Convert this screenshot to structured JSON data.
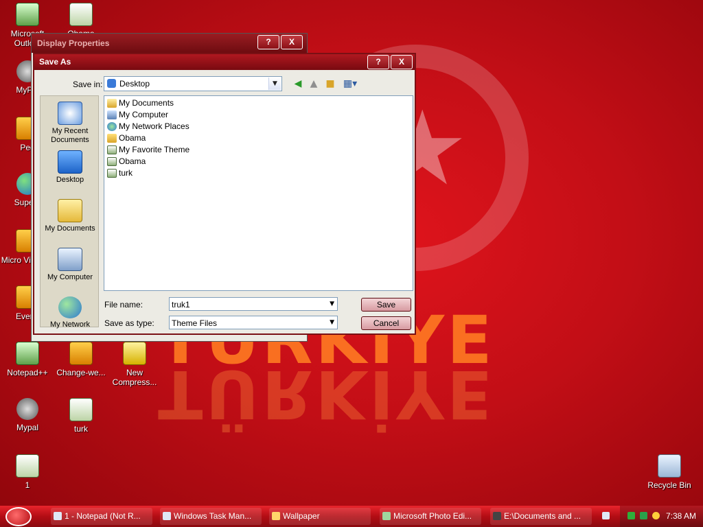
{
  "desktop": {
    "wordmark": "TÜRKİYE",
    "icons": [
      {
        "label": "Microsoft Outlo...",
        "glyph": "outlook-icon"
      },
      {
        "label": "Obama",
        "glyph": "image-file-icon"
      },
      {
        "label": "MyPal",
        "glyph": "raccoon-icon"
      },
      {
        "label": "Peg",
        "glyph": "app-icon"
      },
      {
        "label": "Supern",
        "glyph": "globe-icon"
      },
      {
        "label": "Micro Visual S",
        "glyph": "app-icon"
      },
      {
        "label": "Everyt",
        "glyph": "search-app-icon"
      },
      {
        "label": "Notepad++",
        "glyph": "notepad-icon"
      },
      {
        "label": "Change-we...",
        "glyph": "app-icon"
      },
      {
        "label": "New Compress...",
        "glyph": "zip-folder-icon"
      },
      {
        "label": "Mypal",
        "glyph": "raccoon-icon"
      },
      {
        "label": "turk",
        "glyph": "image-file-icon"
      },
      {
        "label": "1",
        "glyph": "script-icon"
      },
      {
        "label": "Recycle Bin",
        "glyph": "recycle-bin-icon"
      }
    ]
  },
  "back_window": {
    "title": "Display Properties",
    "help": "?",
    "close": "X"
  },
  "dialog": {
    "title": "Save As",
    "help": "?",
    "close": "X",
    "save_in_label": "Save in:",
    "save_in_value": "Desktop",
    "places": [
      {
        "label": "My Recent Documents",
        "icon": "recent-documents-icon"
      },
      {
        "label": "Desktop",
        "icon": "desktop-icon"
      },
      {
        "label": "My Documents",
        "icon": "my-documents-icon"
      },
      {
        "label": "My Computer",
        "icon": "my-computer-icon"
      },
      {
        "label": "My Network",
        "icon": "network-icon"
      }
    ],
    "files": [
      {
        "name": "My Documents",
        "icon": "folder-documents-icon"
      },
      {
        "name": "My Computer",
        "icon": "computer-icon"
      },
      {
        "name": "My Network Places",
        "icon": "network-places-icon"
      },
      {
        "name": "Obama",
        "icon": "folder-icon"
      },
      {
        "name": "My Favorite Theme",
        "icon": "theme-file-icon"
      },
      {
        "name": "Obama",
        "icon": "theme-file-icon"
      },
      {
        "name": "turk",
        "icon": "theme-file-icon"
      }
    ],
    "file_name_label": "File name:",
    "file_name_value": "truk1",
    "save_type_label": "Save as type:",
    "save_type_value": "Theme Files",
    "save_button": "Save",
    "cancel_button": "Cancel"
  },
  "taskbar": {
    "tasks": [
      {
        "label": "1 - Notepad (Not R..."
      },
      {
        "label": "Windows Task Man..."
      },
      {
        "label": "Wallpaper"
      },
      {
        "label": "Microsoft Photo Edi..."
      },
      {
        "label": "E:\\Documents and ..."
      }
    ],
    "clock": "7:38 AM"
  }
}
